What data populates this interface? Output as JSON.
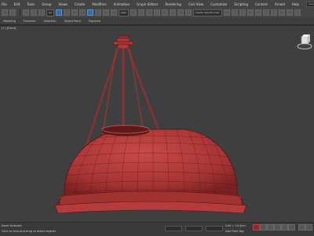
{
  "menu": {
    "items": [
      "File",
      "Edit",
      "Tools",
      "Group",
      "Views",
      "Create",
      "Modifiers",
      "Animation",
      "Graph Editors",
      "Rendering",
      "Civil View",
      "Customize",
      "Scripting",
      "Content",
      "Arnold",
      "Help"
    ],
    "search_placeholder": "Search"
  },
  "toolbar": {
    "selection_filter": "All",
    "reference_coord": "View",
    "named_selection": "Create Selection Set"
  },
  "ribbon": {
    "tabs": [
      "Modeling",
      "Freeform",
      "Selection",
      "Object Paint",
      "Populate"
    ]
  },
  "viewport": {
    "label": "[+] [Front]",
    "model_color": "#b03a3a",
    "wire_color": "#5a1010"
  },
  "status": {
    "left_text": "None Selected",
    "prompt": "Click or click-and-drag to select objects",
    "grid_text": "Grid = 10.0cm",
    "time_tag": "Add Time Tag",
    "key_mode": "Auto Key",
    "set_key": "Set Key",
    "selected": "Selected",
    "frame": "0"
  }
}
